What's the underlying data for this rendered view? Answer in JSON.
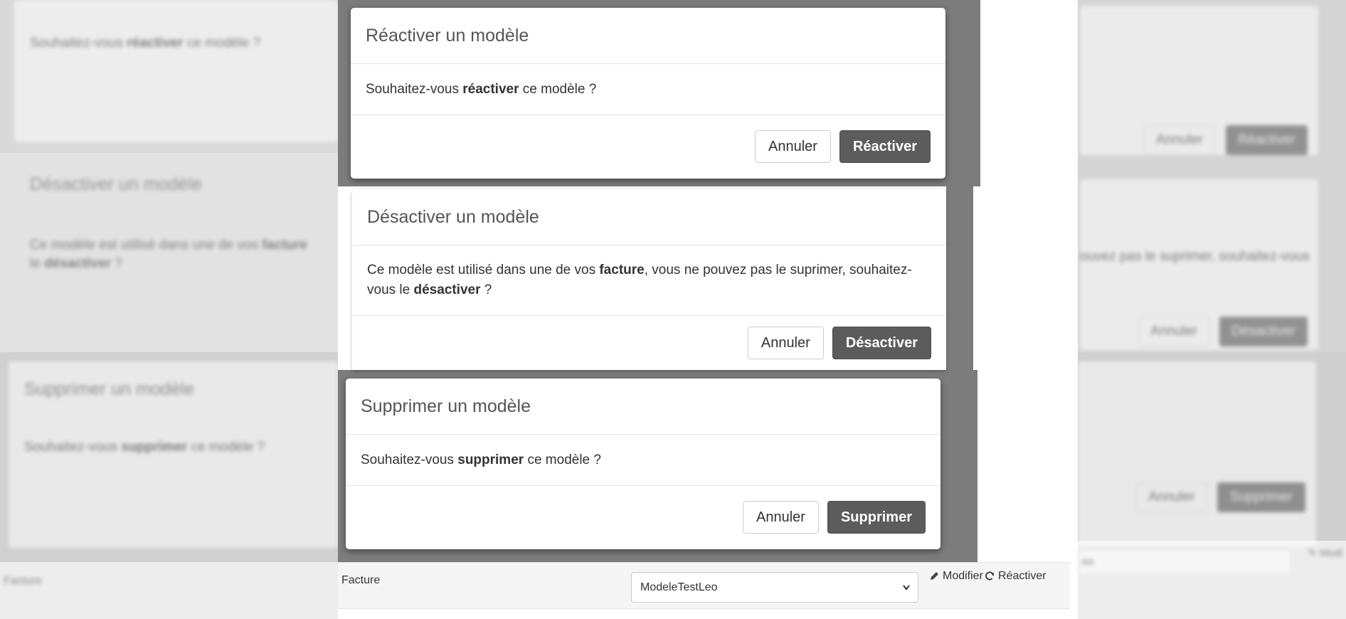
{
  "modals": {
    "reactivate": {
      "title": "Réactiver un modèle",
      "body_prefix": "Souhaitez-vous ",
      "body_bold": "réactiver",
      "body_suffix": " ce modèle ?",
      "cancel_label": "Annuler",
      "confirm_label": "Réactiver"
    },
    "deactivate": {
      "title": "Désactiver un modèle",
      "body_prefix": "Ce modèle est utilisé dans une de vos ",
      "body_bold1": "facture",
      "body_middle": ", vous ne pouvez pas le suprimer, souhaitez-vous le ",
      "body_bold2": "désactiver",
      "body_suffix": " ?",
      "cancel_label": "Annuler",
      "confirm_label": "Désactiver"
    },
    "delete": {
      "title": "Supprimer un modèle",
      "body_prefix": "Souhaitez-vous ",
      "body_bold": "supprimer",
      "body_suffix": " ce modèle ?",
      "cancel_label": "Annuler",
      "confirm_label": "Supprimer"
    }
  },
  "row": {
    "label": "Facture",
    "select_value": "ModeleTestLeo",
    "modify_label": "Modifier",
    "reactivate_label": "Réactiver"
  },
  "ghost_fragments": {
    "right_deactivate_text": "ouvez pas le suprimer, souhaitez-vous",
    "right_select_text": "eo",
    "right_modify_text": "Modi"
  },
  "colors": {
    "primary_button": "#5c5c5c",
    "overlay": "#7c7c7c"
  }
}
